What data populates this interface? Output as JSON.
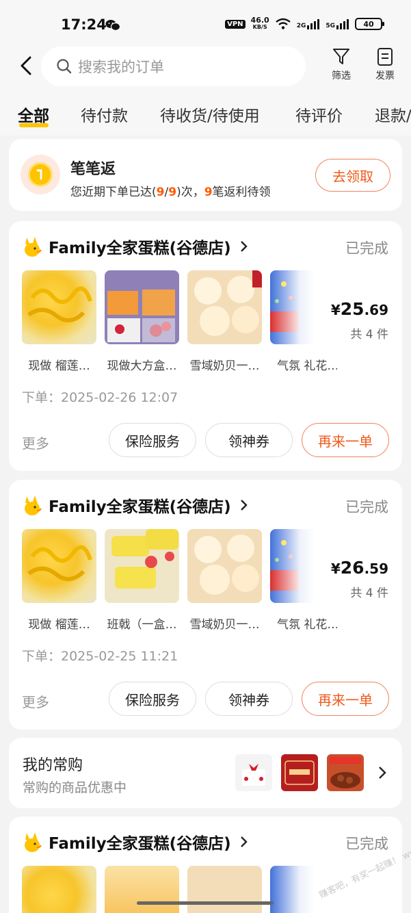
{
  "status": {
    "time": "17:24",
    "vpn": "VPN",
    "speed": "46.0",
    "speed_unit": "KB/S",
    "sig1": "2G",
    "sig2": "5G",
    "battery": "40"
  },
  "search": {
    "placeholder": "搜索我的订单"
  },
  "header": {
    "filter_label": "筛选",
    "invoice_label": "发票"
  },
  "tabs": [
    "全部",
    "待付款",
    "待收货/待使用",
    "待评价",
    "退款/"
  ],
  "rebate": {
    "title": "笔笔返",
    "desc_prefix": "您近期下单已达(",
    "n1": "9",
    "slash": "/",
    "n2": "9",
    "desc_mid": ")次，",
    "n3": "9",
    "desc_suffix": "笔返利待领",
    "claim": "去领取"
  },
  "orders": [
    {
      "shop": "Family全家蛋糕(谷德店)",
      "status": "已完成",
      "items": [
        "现做 榴莲…",
        "现做大方盒…",
        "雪域奶贝一…",
        "气氛 礼花…"
      ],
      "price_symbol": "¥",
      "price_int": "25",
      "price_dec": ".69",
      "count": "共 4 件",
      "time": "下单：2025-02-26 12:07",
      "more": "更多",
      "btn1": "保险服务",
      "btn2": "领神券",
      "btn3": "再来一单"
    },
    {
      "shop": "Family全家蛋糕(谷德店)",
      "status": "已完成",
      "items": [
        "现做 榴莲…",
        "班戟（一盒…",
        "雪域奶贝一…",
        "气氛 礼花…"
      ],
      "price_symbol": "¥",
      "price_int": "26",
      "price_dec": ".59",
      "count": "共 4 件",
      "time": "下单：2025-02-25 11:21",
      "more": "更多",
      "btn1": "保险服务",
      "btn2": "领神券",
      "btn3": "再来一单"
    },
    {
      "shop": "Family全家蛋糕(谷德店)",
      "status": "已完成"
    }
  ],
  "frequent": {
    "title": "我的常购",
    "subtitle": "常购的商品优惠中"
  },
  "watermark": "赚客吧，有奖一起赚！ www.zuanke8.com",
  "colors": {
    "accent": "#ff5a00",
    "tab_underline": "#ffc300",
    "background": "#f3f3f3"
  }
}
